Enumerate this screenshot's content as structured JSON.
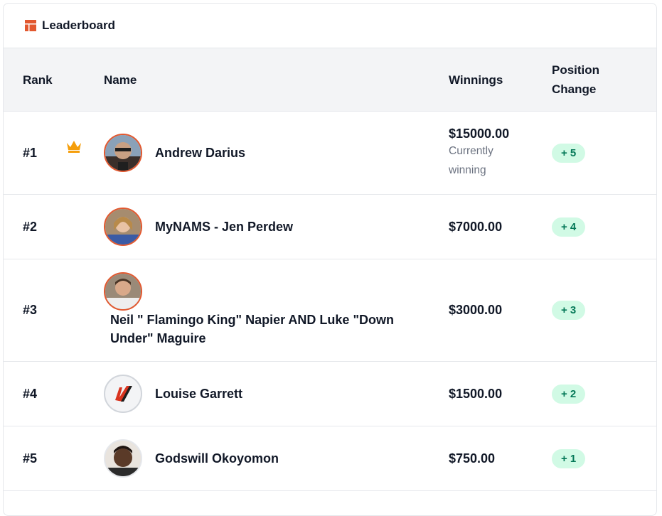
{
  "header": {
    "title": "Leaderboard"
  },
  "columns": {
    "rank": "Rank",
    "name": "Name",
    "winnings": "Winnings",
    "position_change": "Position Change"
  },
  "rows": [
    {
      "rank": "#1",
      "name": "Andrew Darius",
      "winnings": "$15000.00",
      "note": "Currently winning",
      "change": "+ 5",
      "leader_icon": "crown-icon"
    },
    {
      "rank": "#2",
      "name": "MyNAMS - Jen Perdew",
      "winnings": "$7000.00",
      "change": "+ 4"
    },
    {
      "rank": "#3",
      "name": "Neil \" Flamingo King\" Napier AND Luke \"Down Under\" Maguire",
      "winnings": "$3000.00",
      "change": "+ 3"
    },
    {
      "rank": "#4",
      "name": "Louise Garrett",
      "winnings": "$1500.00",
      "change": "+ 2"
    },
    {
      "rank": "#5",
      "name": "Godswill Okoyomon",
      "winnings": "$750.00",
      "change": "+ 1"
    }
  ],
  "colors": {
    "accent": "#e2582f",
    "badge_bg": "#d1fae5",
    "badge_text": "#047857",
    "crown": "#f59e0b",
    "header_bg": "#f3f4f6"
  }
}
